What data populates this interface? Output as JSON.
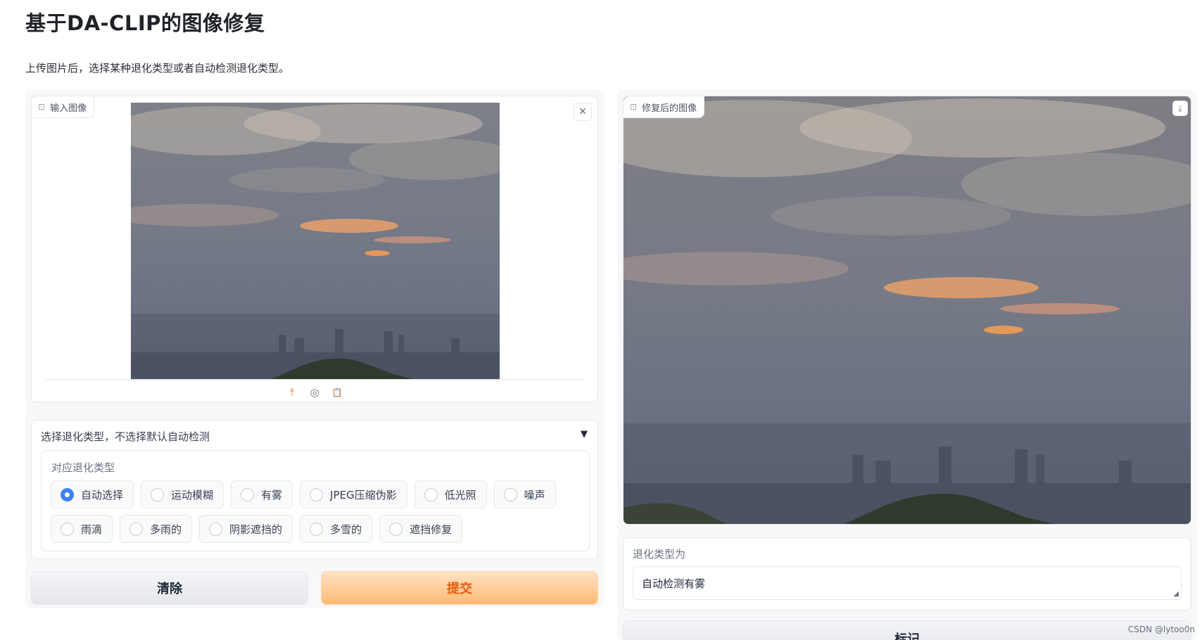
{
  "page": {
    "title": "基于DA-CLIP的图像修复",
    "subtitle": "上传图片后，选择某种退化类型或者自动检测退化类型。"
  },
  "input_image": {
    "label": "输入图像",
    "label_icon": "image-icon",
    "clear_icon": "close-icon",
    "sources": [
      {
        "icon": "upload-icon",
        "glyph": "⤒",
        "active": true
      },
      {
        "icon": "webcam-icon",
        "glyph": "◎",
        "active": false
      },
      {
        "icon": "clipboard-icon",
        "glyph": "📋",
        "active": false
      }
    ]
  },
  "degradation": {
    "accordion_label": "选择退化类型，不选择默认自动检测",
    "accordion_arrow": "▼",
    "radio_label": "对应退化类型",
    "selected": "自动选择",
    "options_row1": [
      "自动选择",
      "运动模糊",
      "有雾",
      "JPEG压缩伪影",
      "低光照",
      "噪声"
    ],
    "options_row2": [
      "雨滴",
      "多雨的",
      "阴影遮挡的",
      "多雪的",
      "遮挡修复"
    ]
  },
  "buttons": {
    "clear_label": "清除",
    "submit_label": "提交",
    "flag_label": "标记"
  },
  "output_image": {
    "label": "修复后的图像",
    "label_icon": "image-icon",
    "download_icon": "download-icon"
  },
  "result": {
    "label": "退化类型为",
    "value": "自动检测有雾"
  },
  "watermark": "CSDN @lytoo0n",
  "colors": {
    "accent_blue": "#3b82f6",
    "submit_orange": "#ea580c",
    "submit_bg": "#fdba74"
  }
}
